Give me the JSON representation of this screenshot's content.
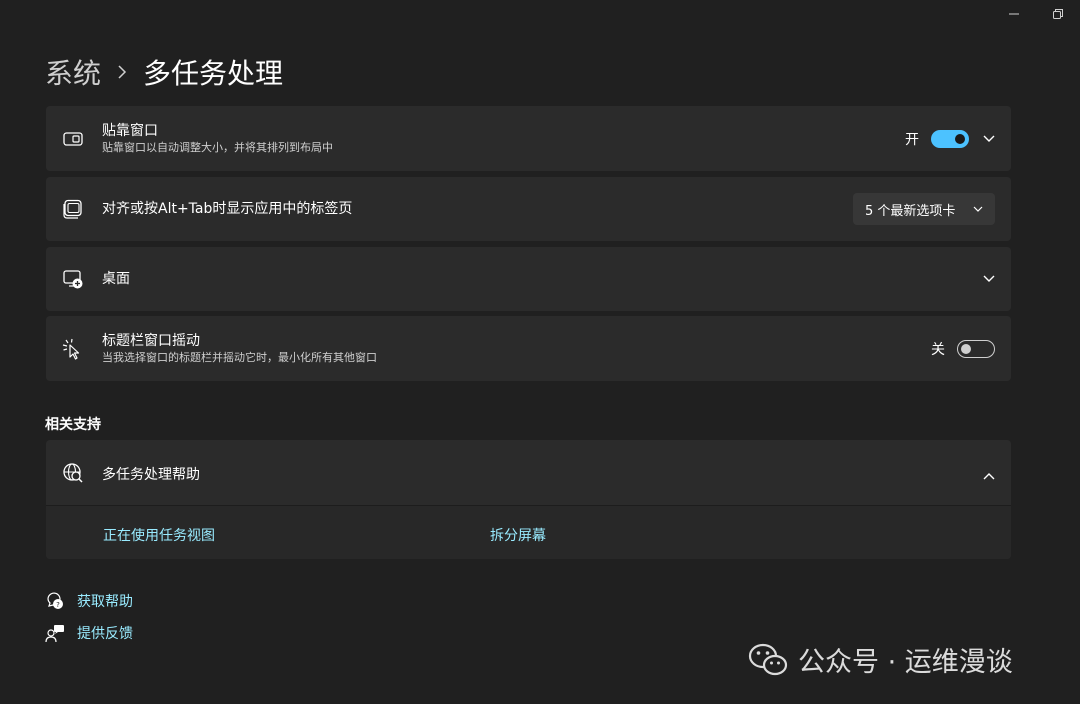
{
  "window": {
    "minimize_icon": "minimize-icon",
    "restore_icon": "restore-icon"
  },
  "breadcrumb": {
    "parent": "系统",
    "current": "多任务处理"
  },
  "cards": {
    "snap": {
      "title": "贴靠窗口",
      "desc": "贴靠窗口以自动调整大小，并将其排列到布局中",
      "state": "开",
      "toggle_on": true
    },
    "alttab": {
      "title": "对齐或按Alt+Tab时显示应用中的标签页",
      "dropdown_value": "5 个最新选项卡"
    },
    "desktop": {
      "title": "桌面"
    },
    "shake": {
      "title": "标题栏窗口摇动",
      "desc": "当我选择窗口的标题栏并摇动它时，最小化所有其他窗口",
      "state": "关",
      "toggle_on": false
    }
  },
  "related": {
    "section_title": "相关支持",
    "help_title": "多任务处理帮助",
    "links": [
      "正在使用任务视图",
      "拆分屏幕"
    ]
  },
  "footer": {
    "get_help": "获取帮助",
    "feedback": "提供反馈"
  },
  "watermark": {
    "text": "公众号 · 运维漫谈"
  },
  "colors": {
    "accent": "#4cc2ff",
    "link": "#99ebff",
    "background": "#202020",
    "card": "#2b2b2b"
  }
}
